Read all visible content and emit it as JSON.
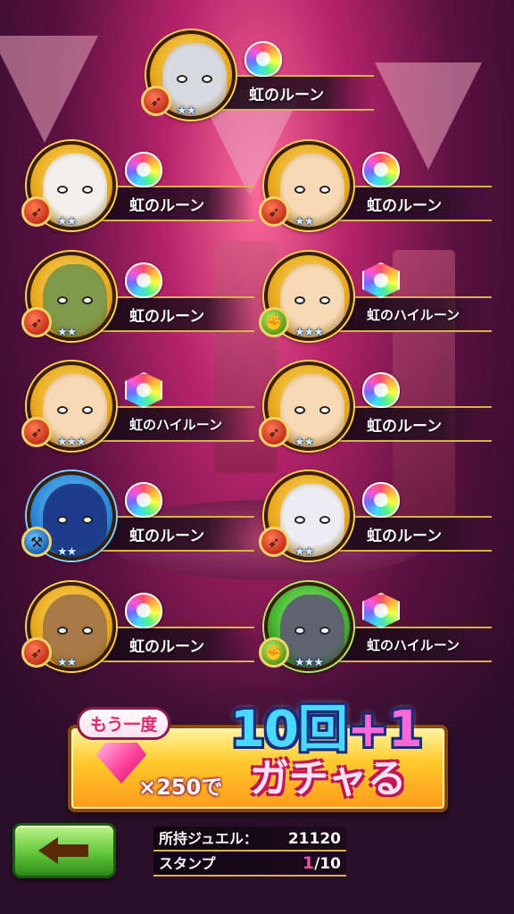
{
  "results": [
    {
      "name": "虹のルーン",
      "rune": "round",
      "frame": "gold",
      "element": "red",
      "element_icon": "bow-icon",
      "stars": "★★"
    },
    {
      "name": "虹のルーン",
      "rune": "round",
      "frame": "gold",
      "element": "red",
      "element_icon": "bow-icon",
      "stars": "★★"
    },
    {
      "name": "虹のルーン",
      "rune": "round",
      "frame": "gold",
      "element": "red",
      "element_icon": "bow-icon",
      "stars": "★★"
    },
    {
      "name": "虹のルーン",
      "rune": "round",
      "frame": "gold",
      "element": "red",
      "element_icon": "bow-icon",
      "stars": "★★"
    },
    {
      "name": "虹のハイルーン",
      "rune": "hex",
      "frame": "gold",
      "element": "green",
      "element_icon": "fist-icon",
      "stars": "★★★"
    },
    {
      "name": "虹のハイルーン",
      "rune": "hex",
      "frame": "gold",
      "element": "red",
      "element_icon": "bow-icon",
      "stars": "★★★"
    },
    {
      "name": "虹のルーン",
      "rune": "round",
      "frame": "gold",
      "element": "red",
      "element_icon": "bow-icon",
      "stars": "★★"
    },
    {
      "name": "虹のルーン",
      "rune": "round",
      "frame": "blue",
      "element": "blue",
      "element_icon": "axe-icon",
      "stars": "★★"
    },
    {
      "name": "虹のルーン",
      "rune": "round",
      "frame": "gold",
      "element": "red",
      "element_icon": "bow-icon",
      "stars": "★★"
    },
    {
      "name": "虹のルーン",
      "rune": "round",
      "frame": "gold",
      "element": "red",
      "element_icon": "bow-icon",
      "stars": "★★"
    },
    {
      "name": "虹のハイルーン",
      "rune": "hex",
      "frame": "green",
      "element": "green",
      "element_icon": "fist-icon",
      "stars": "★★★"
    }
  ],
  "retry": {
    "again_label": "もう一度",
    "gem_cost": "×250で",
    "count_label": "10回+1",
    "count_main": "10回",
    "count_bonus": "+1",
    "action_label": "ガチャる"
  },
  "stats": {
    "jewel_label": "所持ジュエル：",
    "jewel_value": "21120",
    "stamp_label": "スタンプ",
    "stamp_current": "1",
    "stamp_total": "/10"
  },
  "colors": {
    "frame_gold": "#e8a81b",
    "frame_blue": "#2a86d6",
    "frame_green": "#3fae2a",
    "stamp_highlight": "#ff4fa4"
  }
}
